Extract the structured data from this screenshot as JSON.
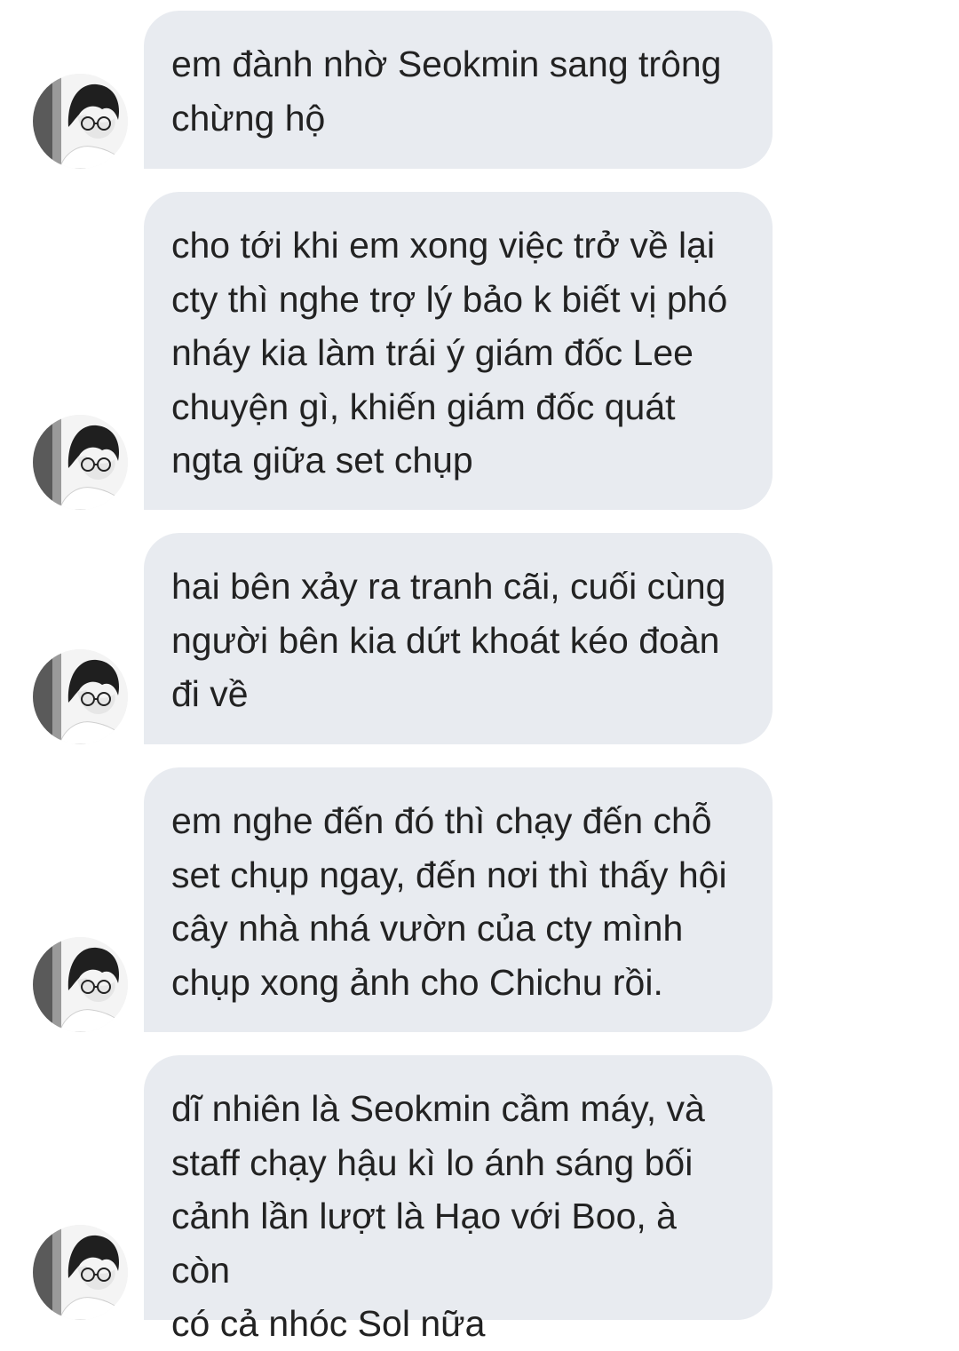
{
  "conversation": {
    "messages": [
      {
        "sender_avatar_icon": "user-avatar-icon",
        "text": "em đành nhờ Seokmin sang trông\nchừng hộ"
      },
      {
        "sender_avatar_icon": "user-avatar-icon",
        "text": "cho tới khi em xong việc trở về lại\ncty thì nghe trợ lý bảo k biết vị phó\nnháy kia làm trái ý giám đốc Lee\nchuyện gì, khiến giám đốc quát\nngta giữa set chụp"
      },
      {
        "sender_avatar_icon": "user-avatar-icon",
        "text": "hai bên xảy ra tranh cãi, cuối cùng\nngười bên kia dứt khoát kéo đoàn\nđi về"
      },
      {
        "sender_avatar_icon": "user-avatar-icon",
        "text": "em nghe đến đó thì chạy đến chỗ\nset chụp ngay, đến nơi thì thấy hội\ncây nhà nhá vườn của cty mình\nchụp xong ảnh cho Chichu rồi."
      },
      {
        "sender_avatar_icon": "user-avatar-icon",
        "text": "dĩ nhiên là Seokmin cầm máy, và\nstaff chạy hậu kì lo ánh sáng bối\ncảnh lần lượt là Hạo với Boo, à còn\ncó cả nhóc Sol nữa"
      }
    ]
  },
  "colors": {
    "bubble_background": "#e8ebf0",
    "text": "#222222",
    "page_background": "#ffffff"
  }
}
